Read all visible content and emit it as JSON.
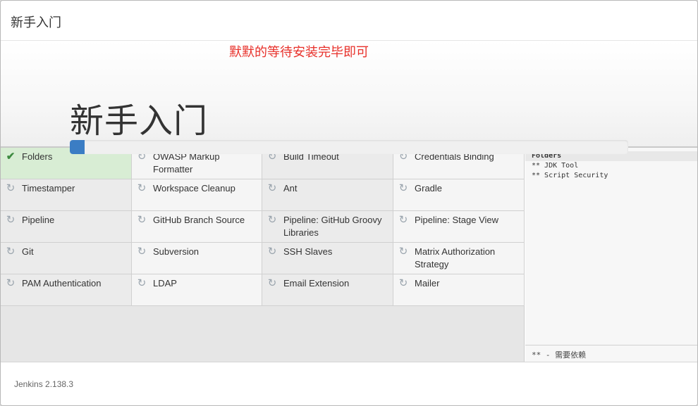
{
  "dialog": {
    "header_title": "新手入门",
    "annotation": "默默的等待安装完毕即可",
    "hero_title": "新手入门",
    "progress_fraction": 0.027
  },
  "plugins": [
    {
      "label": "Folders",
      "status": "done",
      "icon": "check-icon"
    },
    {
      "label": "OWASP Markup Formatter",
      "status": "pending",
      "icon": "refresh-icon"
    },
    {
      "label": "Build Timeout",
      "status": "pending",
      "icon": "refresh-icon"
    },
    {
      "label": "Credentials Binding",
      "status": "pending",
      "icon": "refresh-icon"
    },
    {
      "label": "Timestamper",
      "status": "pending",
      "icon": "refresh-icon"
    },
    {
      "label": "Workspace Cleanup",
      "status": "pending",
      "icon": "refresh-icon"
    },
    {
      "label": "Ant",
      "status": "pending",
      "icon": "refresh-icon"
    },
    {
      "label": "Gradle",
      "status": "pending",
      "icon": "refresh-icon"
    },
    {
      "label": "Pipeline",
      "status": "pending",
      "icon": "refresh-icon"
    },
    {
      "label": "GitHub Branch Source",
      "status": "pending",
      "icon": "refresh-icon"
    },
    {
      "label": "Pipeline: GitHub Groovy Libraries",
      "status": "pending",
      "icon": "refresh-icon"
    },
    {
      "label": "Pipeline: Stage View",
      "status": "pending",
      "icon": "refresh-icon"
    },
    {
      "label": "Git",
      "status": "pending",
      "icon": "refresh-icon"
    },
    {
      "label": "Subversion",
      "status": "pending",
      "icon": "refresh-icon"
    },
    {
      "label": "SSH Slaves",
      "status": "pending",
      "icon": "refresh-icon"
    },
    {
      "label": "Matrix Authorization Strategy",
      "status": "pending",
      "icon": "refresh-icon"
    },
    {
      "label": "PAM Authentication",
      "status": "pending",
      "icon": "refresh-icon"
    },
    {
      "label": "LDAP",
      "status": "pending",
      "icon": "refresh-icon"
    },
    {
      "label": "Email Extension",
      "status": "pending",
      "icon": "refresh-icon"
    },
    {
      "label": "Mailer",
      "status": "pending",
      "icon": "refresh-icon"
    }
  ],
  "log": {
    "lines": [
      "Folders",
      "** JDK Tool",
      "** Script Security"
    ],
    "footer": "** - 需要依赖"
  },
  "footer": {
    "version": "Jenkins 2.138.3"
  },
  "colors": {
    "accent": "#3b7dc4",
    "done": "#d8edd4",
    "annotation": "#e8312b"
  }
}
